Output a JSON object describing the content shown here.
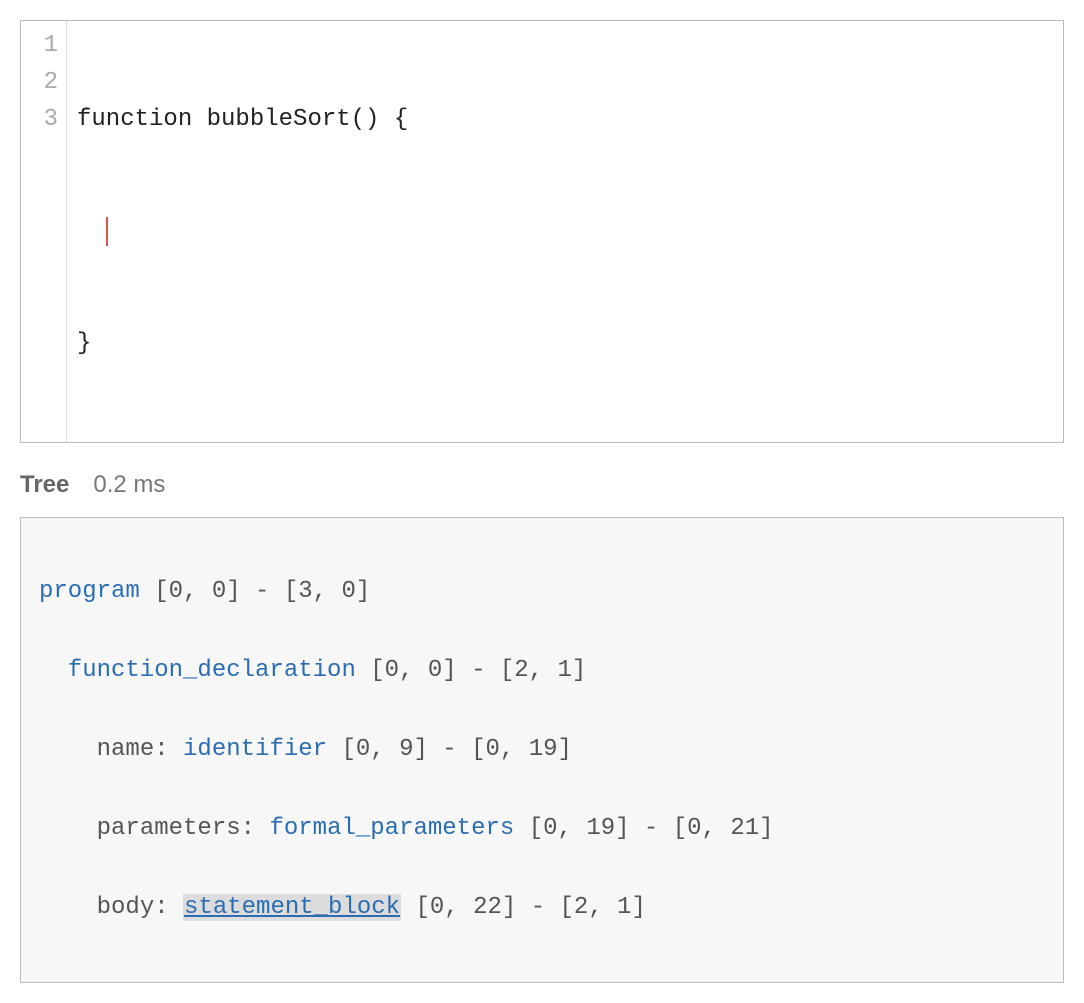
{
  "editor": {
    "line_numbers": [
      "1",
      "2",
      "3"
    ],
    "lines": {
      "l1": "function bubbleSort() {",
      "l2_prefix": "  ",
      "l3": "}"
    }
  },
  "tree_header": {
    "label": "Tree",
    "timing": "0.2 ms"
  },
  "tree": {
    "n1": {
      "type": "program",
      "range": "[0, 0] - [3, 0]"
    },
    "n2": {
      "type": "function_declaration",
      "range": "[0, 0] - [2, 1]"
    },
    "n3": {
      "field": "name:",
      "type": "identifier",
      "range": "[0, 9] - [0, 19]"
    },
    "n4": {
      "field": "parameters:",
      "type": "formal_parameters",
      "range": "[0, 19] - [0, 21]"
    },
    "n5": {
      "field": "body:",
      "type": "statement_block",
      "range": "[0, 22] - [2, 1]"
    }
  }
}
